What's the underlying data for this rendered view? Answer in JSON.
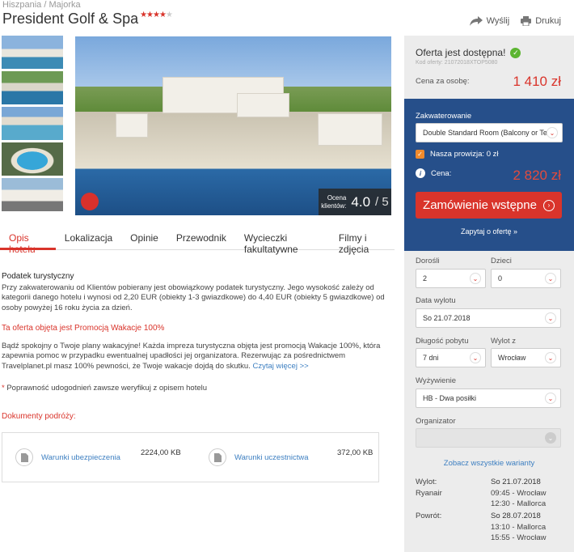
{
  "breadcrumb": {
    "country": "Hiszpania",
    "separator": "/",
    "region": "Majorka"
  },
  "hotel": {
    "name": "President Golf & Spa",
    "stars": "★★★★",
    "empty_stars": "★"
  },
  "actions": {
    "send": "Wyślij",
    "print": "Drukuj"
  },
  "rating": {
    "label_line1": "Ocena",
    "label_line2": "klientów:",
    "value": "4.0",
    "scale": "/ 5"
  },
  "tabs": [
    "Opis hotelu",
    "Lokalizacja",
    "Opinie",
    "Przewodnik",
    "Wycieczki fakultatywne",
    "Filmy i zdjęcia"
  ],
  "content": {
    "tax_heading": "Podatek turystyczny",
    "tax_text": "Przy zakwaterowaniu od Klientów pobierany jest obowiązkowy podatek turystyczny. Jego wysokość zależy od kategorii danego hotelu i wynosi od 2,20 EUR (obiekty 1-3 gwiazdkowe) do 4,40 EUR (obiekty 5 gwiazdkowe) od osoby powyżej 16 roku życia za dzień.",
    "promo_heading": "Ta oferta objęta jest Promocją Wakacje 100%",
    "promo_text": "Bądź spokojny o Twoje plany wakacyjne! Każda impreza turystyczna objęta jest promocją Wakacje 100%, która zapewnia pomoc w przypadku ewentualnej upadłości jej organizatora. Rezerwując za pośrednictwem Travelplanet.pl masz 100% pewności, że Twoje wakacje dojdą do skutku.",
    "read_more": "Czytaj więcej >>",
    "note_star": "*",
    "note_text": " Poprawność udogodnień zawsze weryfikuj z opisem hotelu",
    "docs_heading": "Dokumenty podróży:"
  },
  "documents": [
    {
      "name": "Warunki ubezpieczenia",
      "size": "2224,00 KB"
    },
    {
      "name": "Warunki uczestnictwa",
      "size": "372,00 KB"
    }
  ],
  "offer": {
    "available": "Oferta jest dostępna!",
    "code": "Kod oferty: 21072018XTOP5080",
    "price_label": "Cena za osobę:",
    "price": "1 410 zł",
    "accommodation_label": "Zakwaterowanie",
    "room": "Double Standard Room (Balcony or Te...",
    "provision": "Nasza prowizja: 0 zł",
    "total_label": "Cena:",
    "total": "2 820 zł",
    "order_button": "Zamówienie wstępne",
    "ask": "Zapytaj o ofertę »"
  },
  "form": {
    "adults_label": "Dorośli",
    "adults": "2",
    "children_label": "Dzieci",
    "children": "0",
    "departure_date_label": "Data wylotu",
    "departure_date": "So 21.07.2018",
    "duration_label": "Długość pobytu",
    "duration": "7 dni",
    "from_label": "Wylot z",
    "from": "Wrocław",
    "board_label": "Wyżywienie",
    "board": "HB - Dwa posiłki",
    "organizer_label": "Organizator",
    "organizer": "",
    "all_variants": "Zobacz wszystkie warianty"
  },
  "flights": {
    "out_label": "Wylot:",
    "out_airline": "Ryanair",
    "out_date": "So 21.07.2018",
    "out_dep": "09:45 - Wrocław",
    "out_arr": "12:30 - Mallorca",
    "back_label": "Powrót:",
    "back_date": "So 28.07.2018",
    "back_dep": "13:10 - Mallorca",
    "back_arr": "15:55 - Wrocław"
  },
  "colors": {
    "accent": "#d9342b",
    "panel_blue": "#264f8a",
    "link": "#3d7fc1",
    "ok_green": "#5cb531"
  }
}
